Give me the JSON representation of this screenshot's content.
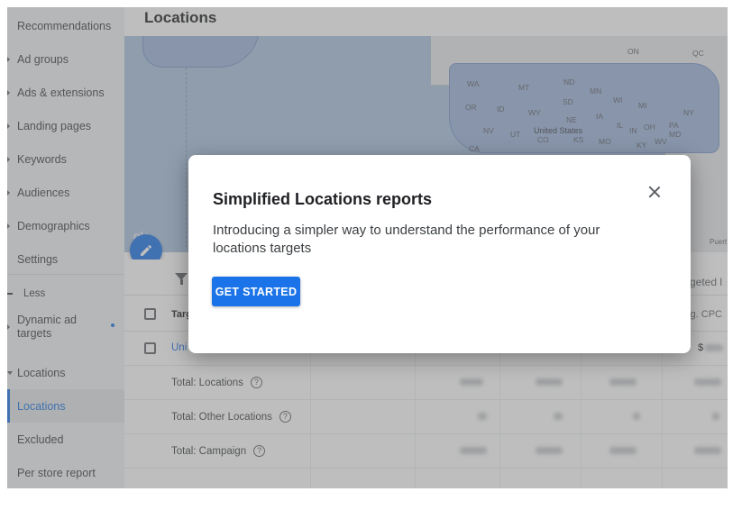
{
  "sidebar": {
    "items": [
      {
        "label": "Recommendations"
      },
      {
        "label": "Ad groups"
      },
      {
        "label": "Ads & extensions"
      },
      {
        "label": "Landing pages"
      },
      {
        "label": "Keywords"
      },
      {
        "label": "Audiences"
      },
      {
        "label": "Demographics"
      },
      {
        "label": "Settings"
      }
    ],
    "less_label": "Less",
    "more_items": [
      {
        "label": "Dynamic ad targets"
      },
      {
        "label": "Locations"
      },
      {
        "label": "Locations",
        "active": true
      },
      {
        "label": "Excluded"
      },
      {
        "label": "Per store report"
      }
    ]
  },
  "header": {
    "title": "Locations"
  },
  "map": {
    "labels": [
      "ON",
      "QC",
      "WA",
      "MT",
      "ND",
      "MN",
      "OR",
      "ID",
      "WY",
      "SD",
      "WI",
      "MI",
      "NY",
      "NE",
      "IA",
      "NV",
      "UT",
      "CO",
      "KS",
      "MO",
      "IL",
      "IN",
      "OH",
      "PA",
      "MD",
      "WV",
      "KY",
      "CA",
      "United States"
    ],
    "attribution_partial": "gle",
    "region_partial": "Puert"
  },
  "table": {
    "header_partial": "Targ",
    "right_header_top": "rgeted l",
    "right_header_cpc": "g. CPC",
    "first_row_link": "Uni",
    "first_row_value": "$",
    "rows": [
      {
        "label": "Total: Locations"
      },
      {
        "label": "Total: Other Locations"
      },
      {
        "label": "Total: Campaign"
      }
    ],
    "help_glyph": "?"
  },
  "dialog": {
    "title": "Simplified Locations reports",
    "body": "Introducing a simpler way to understand the performance of your locations targets",
    "cta_label": "GET STARTED"
  },
  "colors": {
    "accent": "#1a73e8",
    "scrim": "#6e6e6e",
    "sidebar_bg": "#f1f3f4"
  },
  "icons": [
    "edit-pencil-icon",
    "filter-icon",
    "close-icon",
    "help-icon",
    "expand-triangle-icon"
  ]
}
